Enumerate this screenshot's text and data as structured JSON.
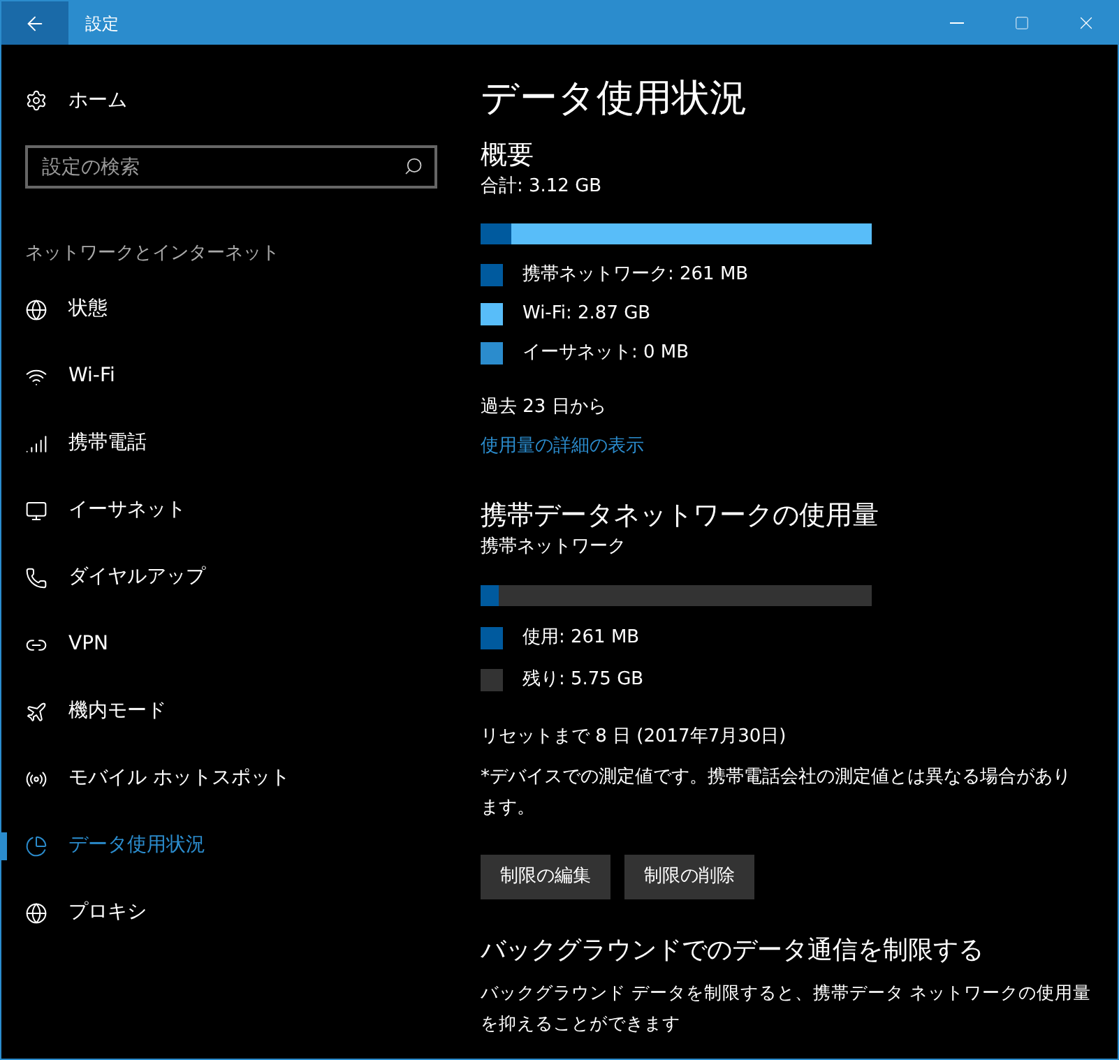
{
  "window": {
    "title": "設定"
  },
  "sidebar": {
    "home": "ホーム",
    "search": {
      "placeholder": "設定の検索"
    },
    "section": "ネットワークとインターネット",
    "items": [
      {
        "kind": "status",
        "label": "状態",
        "selected": false
      },
      {
        "kind": "wifi",
        "label": "Wi-Fi",
        "selected": false
      },
      {
        "kind": "cellular",
        "label": "携帯電話",
        "selected": false
      },
      {
        "kind": "ethernet",
        "label": "イーサネット",
        "selected": false
      },
      {
        "kind": "dialup",
        "label": "ダイヤルアップ",
        "selected": false
      },
      {
        "kind": "vpn",
        "label": "VPN",
        "selected": false
      },
      {
        "kind": "airplane",
        "label": "機内モード",
        "selected": false
      },
      {
        "kind": "hotspot",
        "label": "モバイル ホットスポット",
        "selected": false
      },
      {
        "kind": "data",
        "label": "データ使用状況",
        "selected": true
      },
      {
        "kind": "proxy",
        "label": "プロキシ",
        "selected": false
      }
    ]
  },
  "page_title": "データ使用状況",
  "overview": {
    "heading": "概要",
    "total": "合計: 3.12 GB",
    "segments": [
      {
        "label": "携帯ネットワーク: 261 MB",
        "color": "#005a9e",
        "level": 0.08
      },
      {
        "label": "Wi-Fi: 2.87 GB",
        "color": "#58bdf9",
        "level": 0.92
      },
      {
        "label": "イーサネット: 0 MB",
        "color": "#2b8ccd"
      }
    ],
    "period": "過去 23 日から",
    "link": "使用量の詳細の表示"
  },
  "cellular": {
    "heading": "携帯データネットワークの使用量",
    "network": "携帯ネットワーク",
    "level": 0.045,
    "legend": [
      {
        "label": "使用: 261 MB",
        "color": "#005a9e"
      },
      {
        "label": "残り: 5.75 GB",
        "color": "#333333"
      }
    ],
    "reset": "リセットまで 8 日 (2017年7月30日)",
    "note": "*デバイスでの測定値です。携帯電話会社の測定値とは異なる場合があります。",
    "buttons": [
      "制限の編集",
      "制限の削除"
    ]
  },
  "background": {
    "heading": "バックグラウンドでのデータ通信を制限する",
    "description": "バックグラウンド データを制限すると、携帯データ ネットワークの使用量を抑えることができます"
  }
}
